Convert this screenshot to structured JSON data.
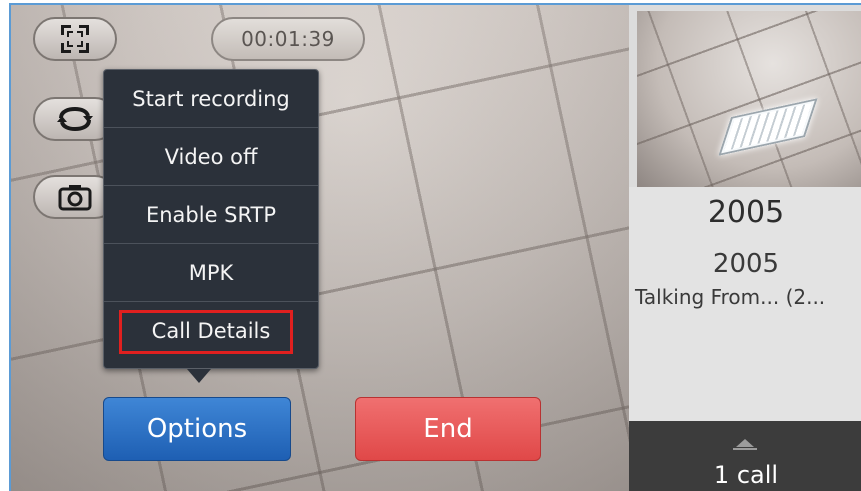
{
  "call": {
    "timer": "00:01:39"
  },
  "controls": {
    "fullscreen_icon": "fullscreen-icon",
    "switch_icon": "switch-camera-icon",
    "snapshot_icon": "camera-icon"
  },
  "options_menu": {
    "items": [
      {
        "label": "Start recording"
      },
      {
        "label": "Video off"
      },
      {
        "label": "Enable SRTP"
      },
      {
        "label": "MPK"
      },
      {
        "label": "Call Details",
        "highlighted": true
      }
    ],
    "highlight_color": "#e0201f"
  },
  "buttons": {
    "options_label": "Options",
    "end_label": "End",
    "options_color": "#2a6fc3",
    "end_color": "#e85a5a"
  },
  "remote_party": {
    "name": "2005",
    "number": "2005",
    "status": "Talking From... (2..."
  },
  "call_bar": {
    "count_label": "1 call"
  }
}
